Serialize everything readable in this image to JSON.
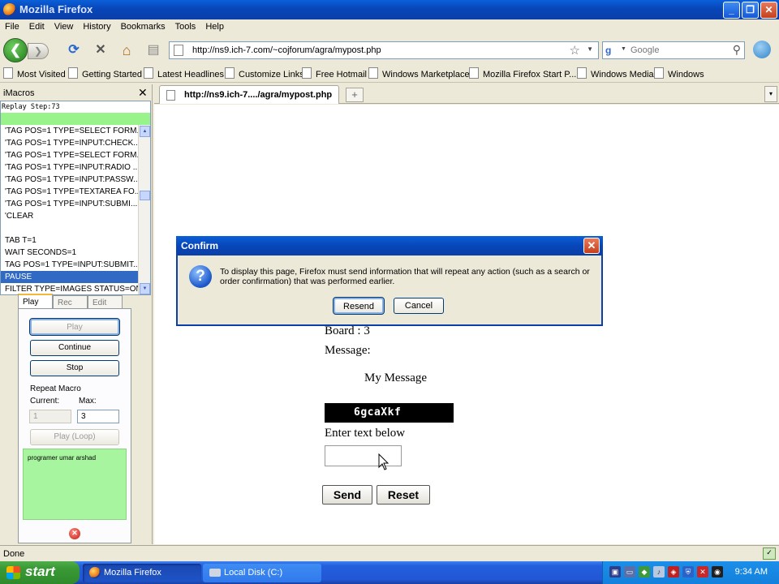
{
  "window": {
    "title": "Mozilla Firefox",
    "min": "_",
    "max": "❐",
    "close": "✕"
  },
  "menu": [
    "File",
    "Edit",
    "View",
    "History",
    "Bookmarks",
    "Tools",
    "Help"
  ],
  "nav": {
    "url": "http://ns9.ich-7.com/~cojforum/agra/mypost.php",
    "search_placeholder": "Google",
    "back_glyph": "❮",
    "fwd_glyph": "❯",
    "reload_glyph": "⟳",
    "stop_glyph": "✕",
    "home_glyph": "⌂",
    "star_glyph": "☆",
    "search_glyph": "⚲"
  },
  "bookmarks": [
    "Most Visited",
    "Getting Started",
    "Latest Headlines",
    "Customize Links",
    "Free Hotmail",
    "Windows Marketplace",
    "Mozilla Firefox Start P...",
    "Windows Media",
    "Windows"
  ],
  "imacros": {
    "title": "iMacros",
    "close_glyph": "✕",
    "status": "Replay Step:73",
    "lines": [
      "'TAG POS=1 TYPE=SELECT FORM...",
      "'TAG POS=1 TYPE=INPUT:CHECK...",
      "'TAG POS=1 TYPE=SELECT FORM...",
      "'TAG POS=1 TYPE=INPUT:RADIO ...",
      "'TAG POS=1 TYPE=INPUT:PASSW...",
      "'TAG POS=1 TYPE=TEXTAREA FO...",
      "'TAG POS=1 TYPE=INPUT:SUBMI...",
      "'CLEAR",
      "",
      "TAB T=1",
      "WAIT SECONDS=1",
      "TAG POS=1 TYPE=INPUT:SUBMIT...",
      "PAUSE",
      "FILTER TYPE=IMAGES STATUS=ON"
    ],
    "selected_line": 12,
    "tabs": [
      "Play",
      "Rec",
      "Edit"
    ],
    "buttons": {
      "play": "Play",
      "continue": "Continue",
      "stop": "Stop",
      "play_loop": "Play (Loop)"
    },
    "repeat_label": "Repeat Macro",
    "current_label": "Current:",
    "max_label": "Max:",
    "current_value": "1",
    "max_value": "3",
    "info_text": "programer umar arshad",
    "stop_glyph": "✕"
  },
  "tab": {
    "label": "http://ns9.ich-7..../agra/mypost.php",
    "new_tab": "+",
    "list": "▾"
  },
  "page": {
    "board": "Board : 3",
    "message_label": "Message:",
    "message_text": "My Message",
    "captcha": "6gcaXkf",
    "enter_label": "Enter text below",
    "send": "Send",
    "reset": "Reset"
  },
  "dialog": {
    "title": "Confirm",
    "close_glyph": "✕",
    "icon": "?",
    "message": "To display this page, Firefox must send information that will repeat any action (such as a search or order confirmation) that was performed earlier.",
    "resend": "Resend",
    "cancel": "Cancel"
  },
  "status": {
    "text": "Done"
  },
  "taskbar": {
    "start": "start",
    "tasks": [
      "Mozilla Firefox",
      "Local Disk (C:)"
    ],
    "clock": "9:34 AM"
  },
  "colors": {
    "xp_blue": "#0a3fa8",
    "green_status": "#98f48a",
    "selection": "#316ac5"
  }
}
